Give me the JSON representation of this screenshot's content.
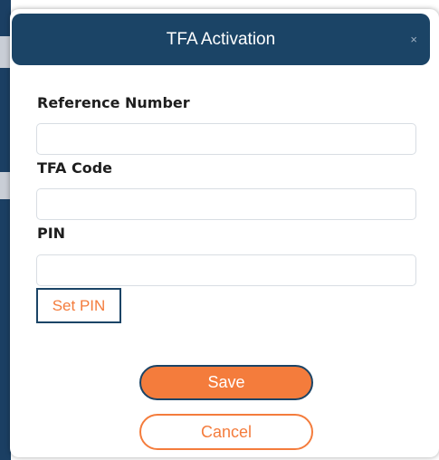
{
  "dialog": {
    "title": "TFA Activation",
    "close_symbol": "×"
  },
  "form": {
    "reference_number": {
      "label": "Reference Number",
      "value": "",
      "placeholder": ""
    },
    "tfa_code": {
      "label": "TFA Code",
      "value": "",
      "placeholder": ""
    },
    "pin": {
      "label": "PIN",
      "value": "",
      "placeholder": ""
    }
  },
  "buttons": {
    "set_pin": "Set PIN",
    "save": "Save",
    "cancel": "Cancel"
  },
  "colors": {
    "header_background": "#1b4466",
    "accent_orange": "#f47c3c",
    "input_border": "#d8dde3"
  },
  "icons": {
    "close": "close-icon"
  }
}
